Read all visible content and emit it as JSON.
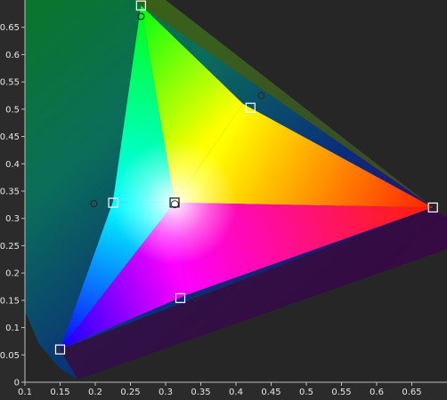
{
  "chart_data": {
    "type": "scatter",
    "title": "",
    "xlabel": "",
    "ylabel": "",
    "xlim": [
      0.1,
      0.7
    ],
    "ylim": [
      0,
      0.7
    ],
    "x_ticks": [
      "0.1",
      "0.15",
      "0.2",
      "0.25",
      "0.3",
      "0.35",
      "0.4",
      "0.45",
      "0.5",
      "0.55",
      "0.6",
      "0.65"
    ],
    "y_ticks": [
      "0",
      "0.05",
      "0.1",
      "0.15",
      "0.2",
      "0.25",
      "0.3",
      "0.35",
      "0.4",
      "0.45",
      "0.5",
      "0.55",
      "0.6",
      "0.65"
    ],
    "grid": false,
    "background_color": "#2b2b2b",
    "plot_background": "#262626",
    "target_gamut": {
      "red": [
        0.68,
        0.32
      ],
      "green": [
        0.265,
        0.69
      ],
      "blue": [
        0.15,
        0.06
      ]
    },
    "target_points": [
      {
        "id": "white",
        "x": 0.3127,
        "y": 0.329
      },
      {
        "id": "cyan",
        "x": 0.2254,
        "y": 0.3287
      },
      {
        "id": "yellow",
        "x": 0.4206,
        "y": 0.5027
      },
      {
        "id": "magenta",
        "x": 0.3209,
        "y": 0.1541
      }
    ],
    "measured_points": [
      {
        "id": "red",
        "x": 0.68,
        "y": 0.32
      },
      {
        "id": "green",
        "x": 0.265,
        "y": 0.67
      },
      {
        "id": "blue",
        "x": 0.15,
        "y": 0.06
      },
      {
        "id": "cyan",
        "x": 0.198,
        "y": 0.327
      },
      {
        "id": "yellow",
        "x": 0.436,
        "y": 0.525
      },
      {
        "id": "magenta",
        "x": 0.342,
        "y": 0.155
      },
      {
        "id": "white",
        "x": 0.313,
        "y": 0.326
      }
    ]
  }
}
